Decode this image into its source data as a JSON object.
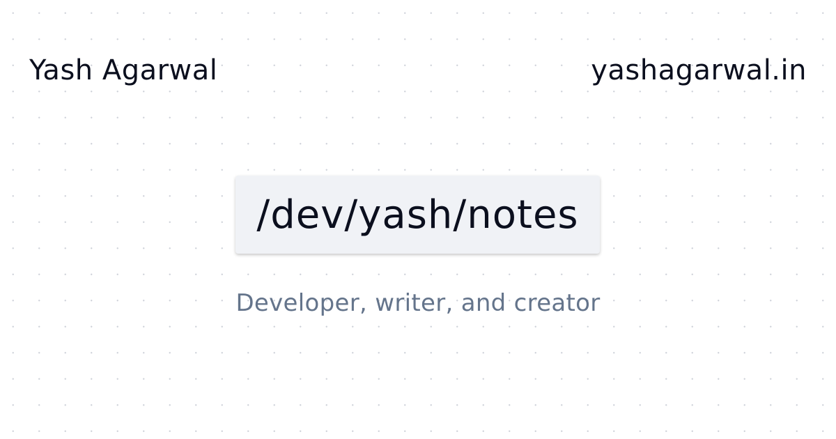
{
  "header": {
    "author": "Yash Agarwal",
    "site": "yashagarwal.in"
  },
  "main": {
    "title": "/dev/yash/notes",
    "subtitle": "Developer, writer, and creator"
  }
}
